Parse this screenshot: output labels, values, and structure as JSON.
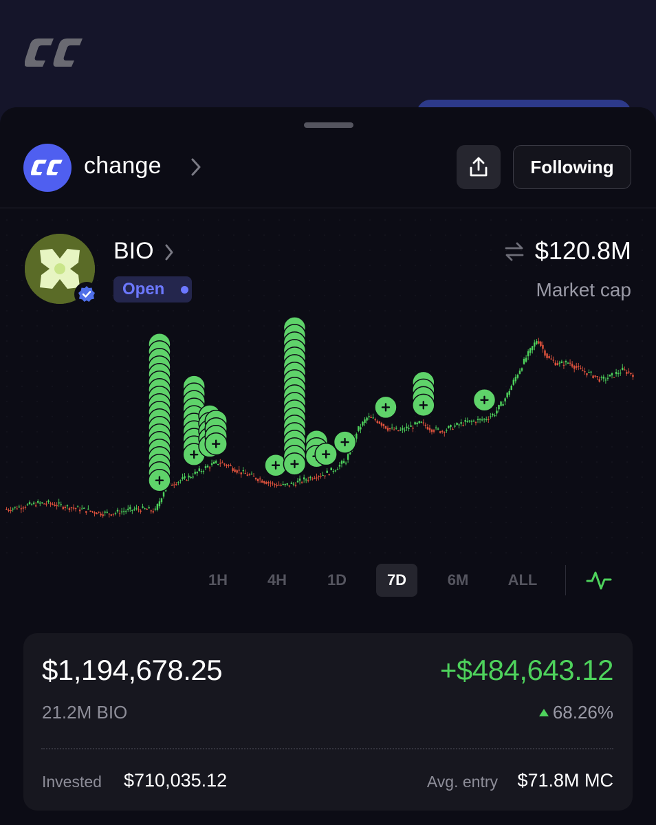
{
  "community": {
    "name": "change"
  },
  "header": {
    "following_label": "Following"
  },
  "token": {
    "symbol": "BIO",
    "status": "Open",
    "market_cap_value": "$120.8M",
    "market_cap_label": "Market cap"
  },
  "timeframes": [
    "1H",
    "4H",
    "1D",
    "7D",
    "6M",
    "ALL"
  ],
  "selected_timeframe": "7D",
  "position": {
    "value": "$1,194,678.25",
    "pnl": "+$484,643.12",
    "holding": "21.2M BIO",
    "pnl_percent": "68.26%",
    "invested_label": "Invested",
    "invested_value": "$710,035.12",
    "avg_entry_label": "Avg. entry",
    "avg_entry_value": "$71.8M MC"
  },
  "colors": {
    "up": "#4ed25c",
    "down": "#e0533d",
    "accent": "#4f5ff0",
    "buy_marker": "#5fd36a"
  },
  "chart_data": {
    "type": "candlestick",
    "timeframe": "7D",
    "series_name": "",
    "close_path_note": "",
    "price_path": [
      0.05,
      0.06,
      0.07,
      0.08,
      0.08,
      0.07,
      0.06,
      0.05,
      0.04,
      0.03,
      0.03,
      0.04,
      0.05,
      0.05,
      0.04,
      0.17,
      0.19,
      0.21,
      0.24,
      0.27,
      0.29,
      0.27,
      0.24,
      0.22,
      0.2,
      0.18,
      0.17,
      0.18,
      0.2,
      0.22,
      0.23,
      0.26,
      0.3,
      0.45,
      0.52,
      0.5,
      0.46,
      0.45,
      0.47,
      0.49,
      0.46,
      0.45,
      0.47,
      0.49,
      0.5,
      0.51,
      0.54,
      0.62,
      0.73,
      0.83,
      0.92,
      0.82,
      0.79,
      0.8,
      0.76,
      0.74,
      0.71,
      0.73,
      0.76,
      0.74
    ],
    "buy_clusters": [
      {
        "at": 0.245,
        "count": 19
      },
      {
        "at": 0.3,
        "count": 10
      },
      {
        "at": 0.325,
        "count": 5
      },
      {
        "at": 0.335,
        "count": 4
      },
      {
        "at": 0.43,
        "count": 1
      },
      {
        "at": 0.46,
        "count": 19
      },
      {
        "at": 0.495,
        "count": 3
      },
      {
        "at": 0.51,
        "count": 1
      },
      {
        "at": 0.54,
        "count": 1
      },
      {
        "at": 0.605,
        "count": 1
      },
      {
        "at": 0.665,
        "count": 4
      },
      {
        "at": 0.762,
        "count": 1
      }
    ]
  }
}
